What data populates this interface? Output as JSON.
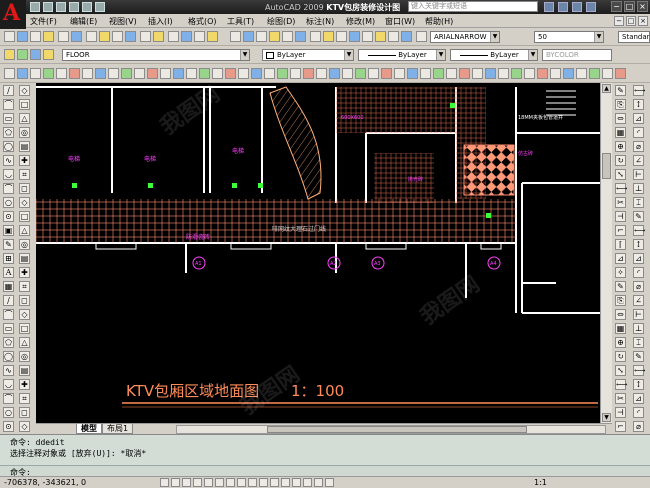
{
  "title_bar": {
    "app_name": "AutoCAD 2009",
    "file_name": "KTV包房装修设计图",
    "search_placeholder": "键入关键字或短语",
    "window_buttons": [
      "−",
      "□",
      "×"
    ]
  },
  "menu": {
    "items": [
      "文件(F)",
      "编辑(E)",
      "视图(V)",
      "插入(I)",
      "格式(O)",
      "工具(T)",
      "绘图(D)",
      "标注(N)",
      "修改(M)",
      "窗口(W)",
      "帮助(H)"
    ],
    "controls": [
      "−",
      "□",
      "×"
    ]
  },
  "styles_toolbar": {
    "text_style": "ARIALNARROW",
    "text_height": "50",
    "dim_style": "Standar"
  },
  "layers_toolbar": {
    "layer": "FLOOR",
    "color": "ByLayer",
    "linetype": "ByLayer",
    "lineweight": "ByLayer",
    "plotstyle": "BYCOLOR"
  },
  "drawing": {
    "title": "KTV包厢区域地面图",
    "scale": "1：100",
    "room_labels": [
      "电梯",
      "电梯",
      "电梯"
    ],
    "pattern_label": "防滑瓷砖",
    "corridor_label": "啡网纹大理石过门线",
    "wall_note": "18MM夹板包管道井",
    "tile_notes": [
      "600X600",
      "抛光砖",
      "仿古砖"
    ],
    "door_marks": [
      "A1",
      "A2",
      "A3",
      "A4"
    ],
    "colors": {
      "background": "#000000",
      "walls": "#ffffff",
      "tile_grid": "#ff8c6e",
      "wood": "#ffb07a",
      "labels": "#ff40ff",
      "title": "#ff8c5a",
      "green_marks": "#3cff3c"
    }
  },
  "layout_tabs": [
    "模型",
    "布局1"
  ],
  "command": {
    "lines": [
      "命令:  ddedit",
      "选择注释对象或 [放弃(U)]: *取消*",
      "命令:"
    ]
  },
  "status_bar": {
    "coordinates": "-706378, -343621, 0",
    "zoom": "1:1"
  },
  "watermark": "我图网"
}
